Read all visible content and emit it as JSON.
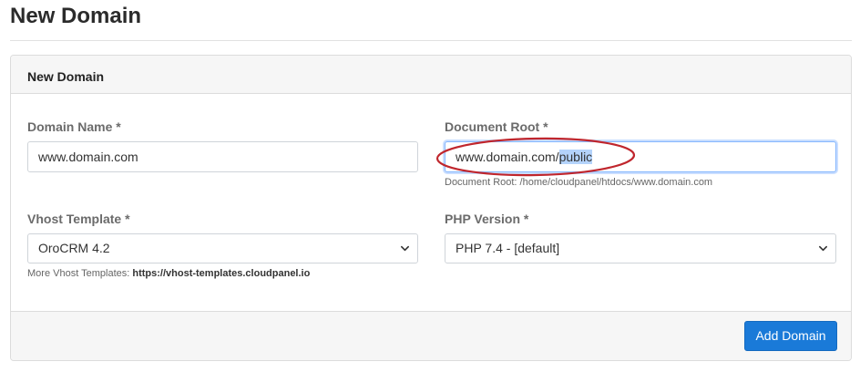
{
  "page": {
    "title": "New Domain"
  },
  "card": {
    "header_title": "New Domain",
    "domain_name": {
      "label": "Domain Name *",
      "value": "www.domain.com"
    },
    "document_root": {
      "label": "Document Root *",
      "value_prefix": "www.domain.com/",
      "value_selected": "public",
      "help": "Document Root: /home/cloudpanel/htdocs/www.domain.com"
    },
    "vhost_template": {
      "label": "Vhost Template *",
      "selected": "OroCRM 4.2",
      "help_prefix": "More Vhost Templates: ",
      "help_link": "https://vhost-templates.cloudpanel.io"
    },
    "php_version": {
      "label": "PHP Version *",
      "selected": "PHP 7.4 - [default]"
    },
    "submit_label": "Add Domain"
  },
  "colors": {
    "primary_button": "#1a7ad8",
    "annotation": "#c0262d",
    "focus": "#86b7fe"
  }
}
